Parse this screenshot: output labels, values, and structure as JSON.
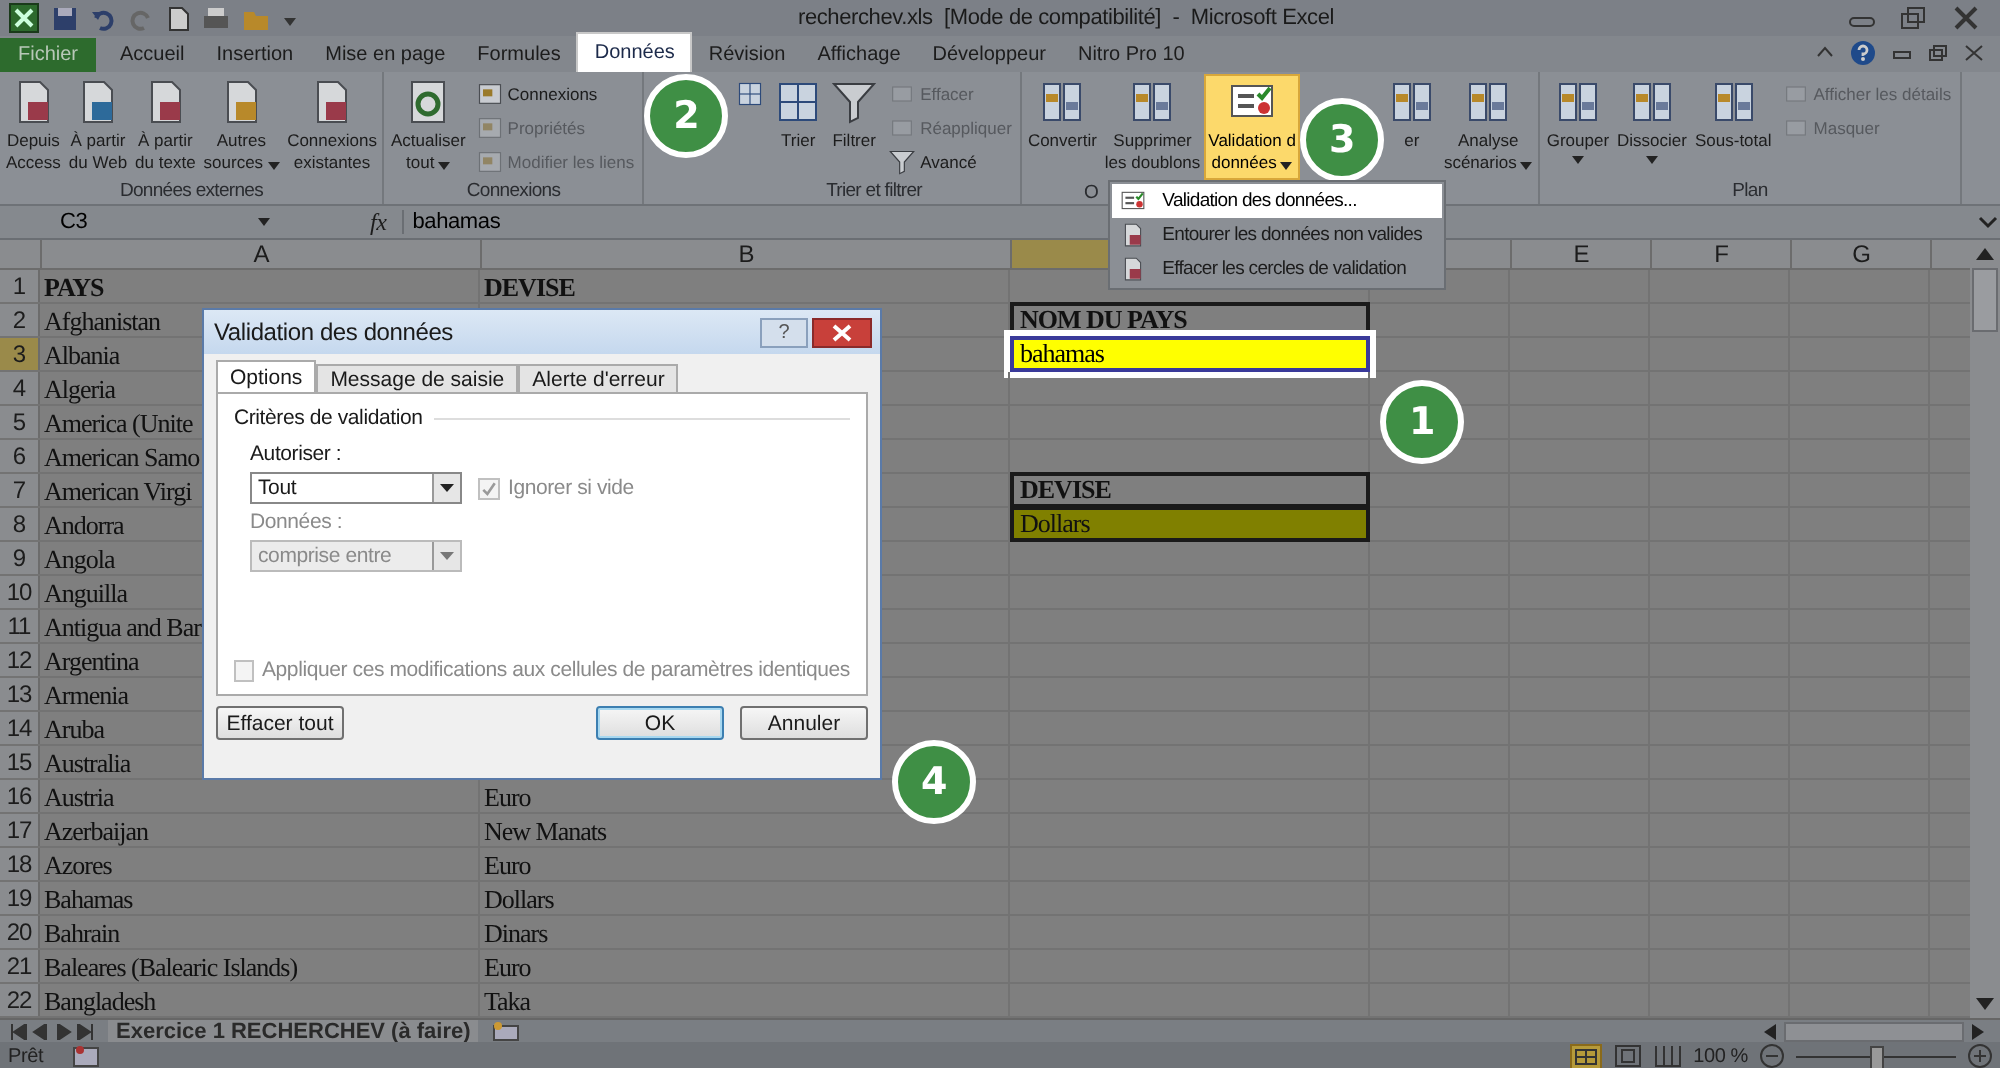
{
  "window": {
    "title": "recherchev.xls  [Mode de compatibilité]  -  Microsoft Excel"
  },
  "tabs": [
    {
      "label": "Fichier",
      "kind": "file",
      "selected": false
    },
    {
      "label": "Accueil",
      "kind": "tab",
      "selected": false
    },
    {
      "label": "Insertion",
      "kind": "tab",
      "selected": false
    },
    {
      "label": "Mise en page",
      "kind": "tab",
      "selected": false
    },
    {
      "label": "Formules",
      "kind": "tab",
      "selected": false
    },
    {
      "label": "Données",
      "kind": "tab",
      "selected": true
    },
    {
      "label": "Révision",
      "kind": "tab",
      "selected": false
    },
    {
      "label": "Affichage",
      "kind": "tab",
      "selected": false
    },
    {
      "label": "Développeur",
      "kind": "tab",
      "selected": false
    },
    {
      "label": "Nitro Pro 10",
      "kind": "tab",
      "selected": false
    }
  ],
  "ribbon": {
    "groups": [
      {
        "label": "Données externes",
        "buttons": [
          {
            "kind": "large",
            "lines": [
              "Depuis",
              "Access"
            ],
            "dropdown": false,
            "disabled": false,
            "pressed": false
          },
          {
            "kind": "large",
            "lines": [
              "À partir",
              "du Web"
            ],
            "dropdown": false,
            "disabled": false,
            "pressed": false
          },
          {
            "kind": "large",
            "lines": [
              "À partir",
              "du texte"
            ],
            "dropdown": false,
            "disabled": false,
            "pressed": false
          },
          {
            "kind": "large",
            "lines": [
              "Autres",
              "sources"
            ],
            "dropdown": true,
            "disabled": false,
            "pressed": false
          },
          {
            "kind": "large",
            "lines": [
              "Connexions",
              "existantes"
            ],
            "dropdown": false,
            "disabled": false,
            "pressed": false
          }
        ]
      },
      {
        "label": "Connexions",
        "buttons": [
          {
            "kind": "large",
            "lines": [
              "Actualiser",
              "tout"
            ],
            "dropdown": true,
            "disabled": false,
            "pressed": false
          },
          {
            "kind": "small",
            "label": "Connexions",
            "dropdown": false,
            "disabled": false,
            "pressed": false
          },
          {
            "kind": "small",
            "label": "Propriétés",
            "dropdown": false,
            "disabled": true,
            "pressed": false
          },
          {
            "kind": "small",
            "label": "Modifier les liens",
            "dropdown": false,
            "disabled": true,
            "pressed": false
          }
        ]
      },
      {
        "label": "Trier et filtrer",
        "buttons": [
          {
            "kind": "icon",
            "dropdown": false,
            "disabled": false,
            "pressed": false
          },
          {
            "kind": "large",
            "lines": [
              "Trier"
            ],
            "dropdown": false,
            "disabled": false,
            "pressed": false
          },
          {
            "kind": "large",
            "lines": [
              "Filtrer"
            ],
            "dropdown": false,
            "disabled": false,
            "pressed": false
          },
          {
            "kind": "small",
            "label": "Effacer",
            "dropdown": false,
            "disabled": true,
            "pressed": false
          },
          {
            "kind": "small",
            "label": "Réappliquer",
            "dropdown": false,
            "disabled": true,
            "pressed": false
          },
          {
            "kind": "small",
            "label": "Avancé",
            "dropdown": false,
            "disabled": false,
            "pressed": false
          }
        ]
      },
      {
        "label": "O",
        "buttons": [
          {
            "kind": "large",
            "lines": [
              "Convertir"
            ],
            "dropdown": false,
            "disabled": false,
            "pressed": false
          },
          {
            "kind": "large",
            "lines": [
              "Supprimer",
              "les doublons"
            ],
            "dropdown": false,
            "disabled": false,
            "pressed": false
          },
          {
            "kind": "large",
            "lines": [
              "Validation d",
              "données"
            ],
            "dropdown": true,
            "disabled": false,
            "pressed": true
          },
          {
            "kind": "large",
            "lines": [
              "er"
            ],
            "dropdown": false,
            "disabled": false,
            "pressed": false
          },
          {
            "kind": "large",
            "lines": [
              "Analyse",
              "scénarios"
            ],
            "dropdown": true,
            "disabled": false,
            "pressed": false
          }
        ]
      },
      {
        "label": "Plan",
        "buttons": [
          {
            "kind": "large",
            "lines": [
              "Grouper"
            ],
            "dropdown": true,
            "disabled": false,
            "pressed": false
          },
          {
            "kind": "large",
            "lines": [
              "Dissocier"
            ],
            "dropdown": true,
            "disabled": false,
            "pressed": false
          },
          {
            "kind": "large",
            "lines": [
              "Sous-total"
            ],
            "dropdown": false,
            "disabled": false,
            "pressed": false
          },
          {
            "kind": "small",
            "label": "Afficher les détails",
            "dropdown": false,
            "disabled": true,
            "pressed": false
          },
          {
            "kind": "small",
            "label": "Masquer",
            "dropdown": false,
            "disabled": true,
            "pressed": false
          }
        ]
      }
    ]
  },
  "validation_menu": {
    "items": [
      {
        "label": "Validation des données...",
        "selected": true
      },
      {
        "label": "Entourer les données non valides",
        "selected": false
      },
      {
        "label": "Effacer les cercles de validation",
        "selected": false
      }
    ]
  },
  "formula_bar": {
    "name_box": "C3",
    "function_label": "fx",
    "value": "bahamas"
  },
  "columns": [
    {
      "label": "A",
      "selected": false
    },
    {
      "label": "B",
      "selected": false
    },
    {
      "selected": true
    },
    {
      "selected": false
    },
    {
      "label": "E",
      "selected": false
    },
    {
      "label": "F",
      "selected": false
    },
    {
      "label": "G",
      "selected": false
    }
  ],
  "rows": [
    {
      "number": "1",
      "selected": false,
      "bold": true,
      "a": "PAYS",
      "b": "DEVISE"
    },
    {
      "number": "2",
      "selected": false,
      "bold": false,
      "a": "Afghanistan",
      "c": {
        "text": "NOM DU PAYS",
        "kind": "label",
        "selected": false
      }
    },
    {
      "number": "3",
      "selected": true,
      "bold": false,
      "a": "Albania",
      "c": {
        "text": "bahamas",
        "kind": "input",
        "selected": true
      }
    },
    {
      "number": "4",
      "selected": false,
      "bold": false,
      "a": "Algeria"
    },
    {
      "number": "5",
      "selected": false,
      "bold": false,
      "a": "America (Unite"
    },
    {
      "number": "6",
      "selected": false,
      "bold": false,
      "a": "American Samo"
    },
    {
      "number": "7",
      "selected": false,
      "bold": false,
      "a": "American Virgi",
      "c": {
        "text": "DEVISE",
        "kind": "label",
        "selected": false
      }
    },
    {
      "number": "8",
      "selected": false,
      "bold": false,
      "a": "Andorra",
      "c": {
        "text": "Dollars",
        "kind": "result",
        "selected": false
      }
    },
    {
      "number": "9",
      "selected": false,
      "bold": false,
      "a": "Angola"
    },
    {
      "number": "10",
      "selected": false,
      "bold": false,
      "a": "Anguilla"
    },
    {
      "number": "11",
      "selected": false,
      "bold": false,
      "a": "Antigua and Bar"
    },
    {
      "number": "12",
      "selected": false,
      "bold": false,
      "a": "Argentina"
    },
    {
      "number": "13",
      "selected": false,
      "bold": false,
      "a": "Armenia"
    },
    {
      "number": "14",
      "selected": false,
      "bold": false,
      "a": "Aruba"
    },
    {
      "number": "15",
      "selected": false,
      "bold": false,
      "a": "Australia"
    },
    {
      "number": "16",
      "selected": false,
      "bold": false,
      "a": "Austria",
      "b": "Euro"
    },
    {
      "number": "17",
      "selected": false,
      "bold": false,
      "a": "Azerbaijan",
      "b": "New Manats"
    },
    {
      "number": "18",
      "selected": false,
      "bold": false,
      "a": "Azores",
      "b": "Euro"
    },
    {
      "number": "19",
      "selected": false,
      "bold": false,
      "a": "Bahamas",
      "b": "Dollars"
    },
    {
      "number": "20",
      "selected": false,
      "bold": false,
      "a": "Bahrain",
      "b": "Dinars"
    },
    {
      "number": "21",
      "selected": false,
      "bold": false,
      "a": "Baleares (Balearic Islands)",
      "b": "Euro"
    },
    {
      "number": "22",
      "selected": false,
      "bold": false,
      "a": "Bangladesh",
      "b": "Taka"
    }
  ],
  "sheet_tabs": [
    {
      "label": "Exercice 1 RECHERCHEV (à faire)",
      "selected": true
    }
  ],
  "status_bar": {
    "status": "Prêt",
    "zoom": "100 %",
    "zoom_slider": {
      "level": 0.5
    }
  },
  "dialog": {
    "title": "Validation des données",
    "help_label": "?",
    "tabs": [
      {
        "label": "Options",
        "selected": true
      },
      {
        "label": "Message de saisie",
        "selected": false
      },
      {
        "label": "Alerte d'erreur",
        "selected": false
      }
    ],
    "section": "Critères de validation",
    "allow": {
      "label": "Autoriser :",
      "value": "Tout",
      "disabled": false
    },
    "ignore_blank": {
      "label": "Ignorer si vide",
      "checked": true,
      "disabled": true
    },
    "data": {
      "label": "Données :",
      "value": "comprise entre",
      "disabled": true
    },
    "apply_all": {
      "label": "Appliquer ces modifications aux cellules de paramètres identiques",
      "checked": false,
      "disabled": true
    },
    "buttons": [
      {
        "label": "Effacer tout",
        "kind": "left",
        "default": false
      },
      {
        "label": "OK",
        "kind": "right",
        "default": true
      },
      {
        "label": "Annuler",
        "kind": "right",
        "default": false
      }
    ]
  },
  "badges": [
    {
      "label": "1"
    },
    {
      "label": "2"
    },
    {
      "label": "3"
    },
    {
      "label": "4"
    }
  ]
}
